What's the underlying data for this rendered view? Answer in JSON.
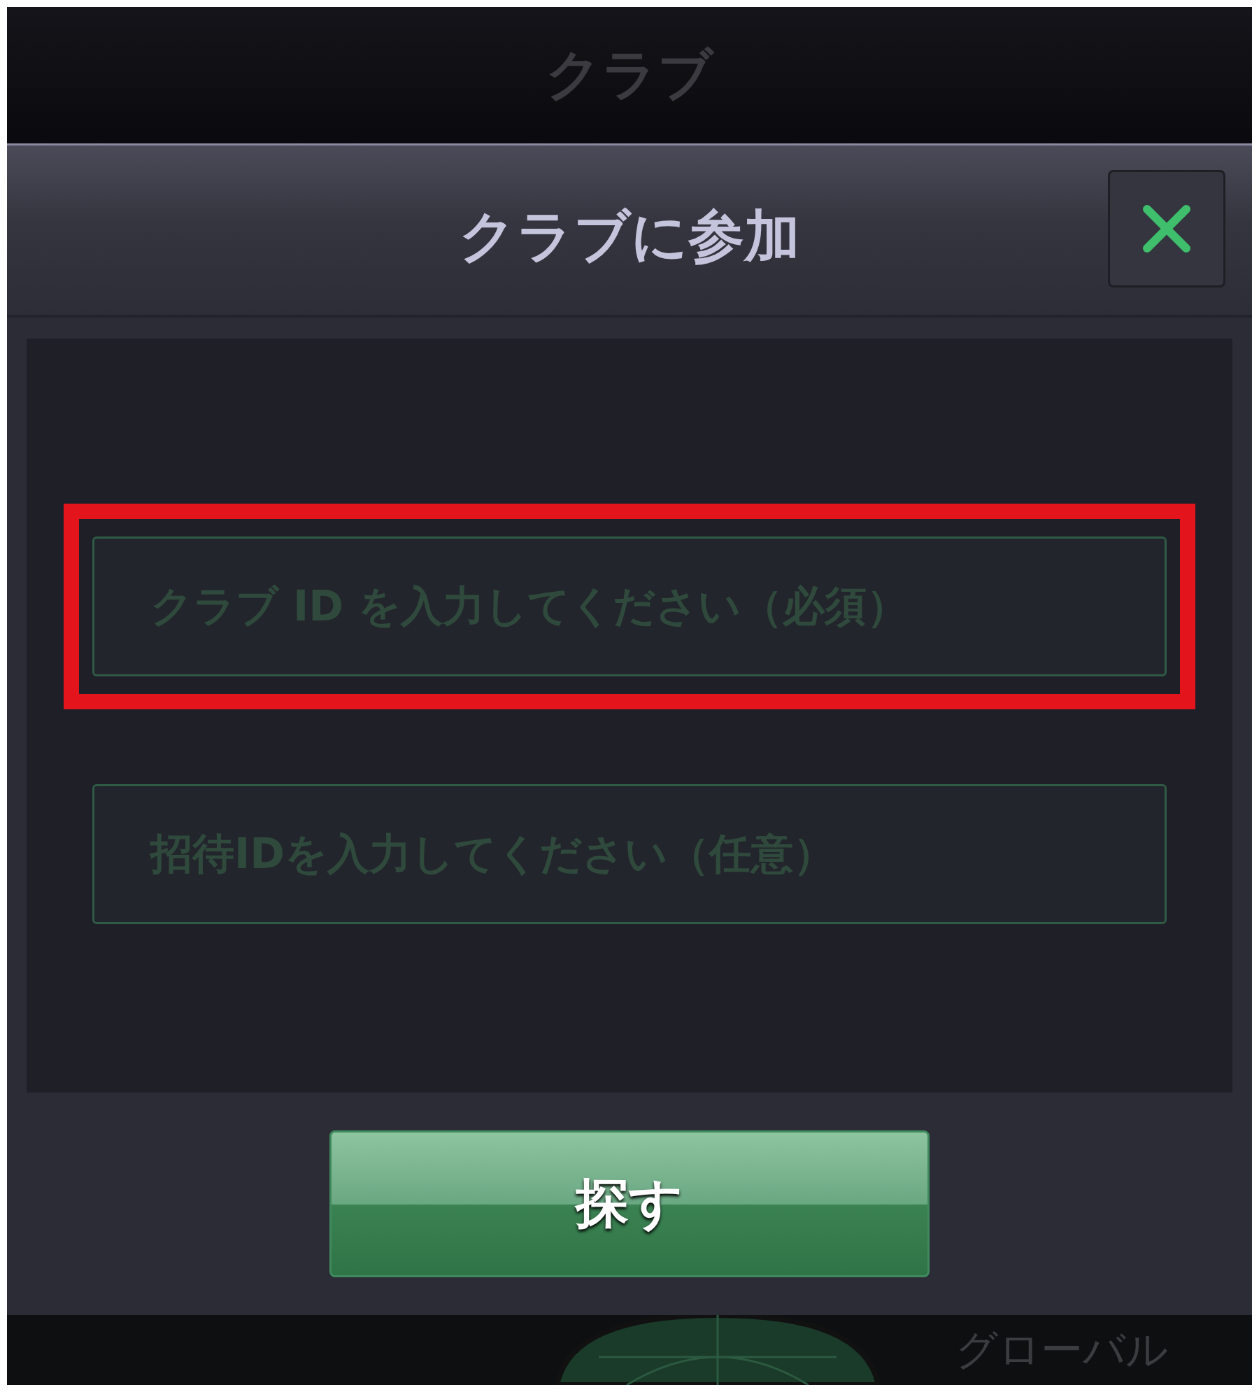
{
  "screen_title": "クラブ",
  "dialog": {
    "title": "クラブに参加",
    "fields": [
      {
        "placeholder": "クラブ ID を入力してください（必須）",
        "highlighted": true
      },
      {
        "placeholder": "招待IDを入力してください（任意）",
        "highlighted": false
      }
    ],
    "button": "探す"
  },
  "bottom_tab": {
    "label": "グローバル"
  }
}
